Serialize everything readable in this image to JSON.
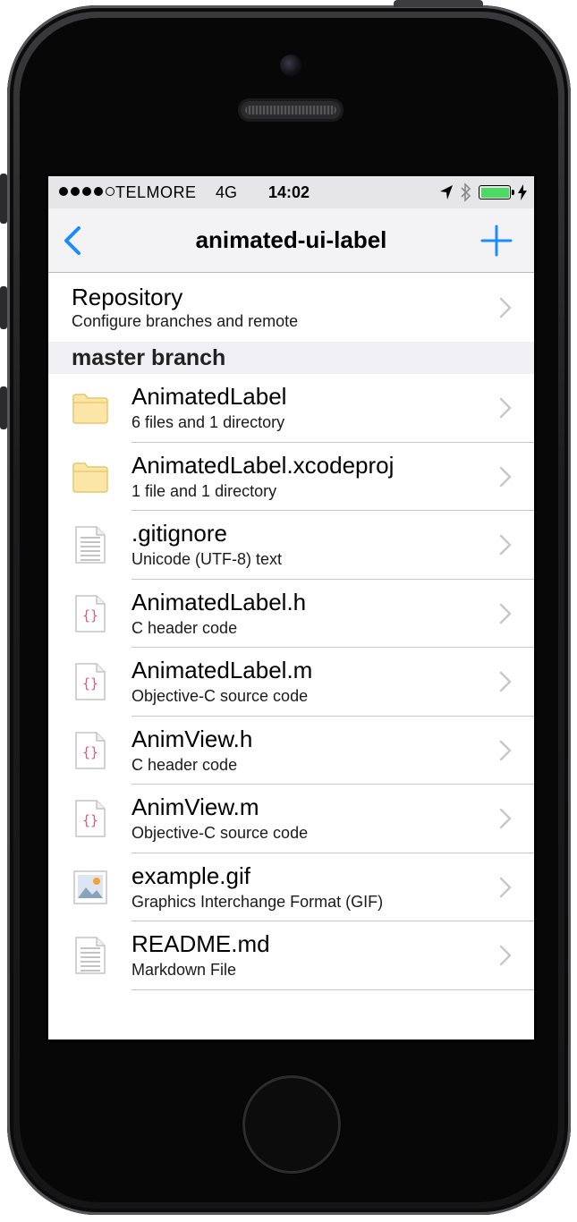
{
  "status_bar": {
    "signal_dots_filled": 4,
    "signal_dots_total": 5,
    "carrier": "TELMORE",
    "network": "4G",
    "time": "14:02",
    "battery_level": 1.0,
    "battery_color": "#4cd964"
  },
  "nav": {
    "title": "animated-ui-label",
    "back_icon": "chevron-left-icon",
    "add_icon": "plus-icon",
    "accent_color": "#1a8cff"
  },
  "repository": {
    "title": "Repository",
    "subtitle": "Configure branches and remote"
  },
  "section": {
    "header": "master branch"
  },
  "files": [
    {
      "name": "AnimatedLabel",
      "detail": "6 files and 1 directory",
      "icon": "folder-icon"
    },
    {
      "name": "AnimatedLabel.xcodeproj",
      "detail": "1 file and 1 directory",
      "icon": "folder-icon"
    },
    {
      "name": ".gitignore",
      "detail": "Unicode (UTF-8) text",
      "icon": "text-document-icon"
    },
    {
      "name": "AnimatedLabel.h",
      "detail": "C header code",
      "icon": "code-file-icon"
    },
    {
      "name": "AnimatedLabel.m",
      "detail": "Objective-C source code",
      "icon": "code-file-icon"
    },
    {
      "name": "AnimView.h",
      "detail": "C header code",
      "icon": "code-file-icon"
    },
    {
      "name": "AnimView.m",
      "detail": "Objective-C source code",
      "icon": "code-file-icon"
    },
    {
      "name": "example.gif",
      "detail": "Graphics Interchange Format (GIF)",
      "icon": "image-file-icon"
    },
    {
      "name": "README.md",
      "detail": "Markdown File",
      "icon": "text-document-icon"
    }
  ]
}
